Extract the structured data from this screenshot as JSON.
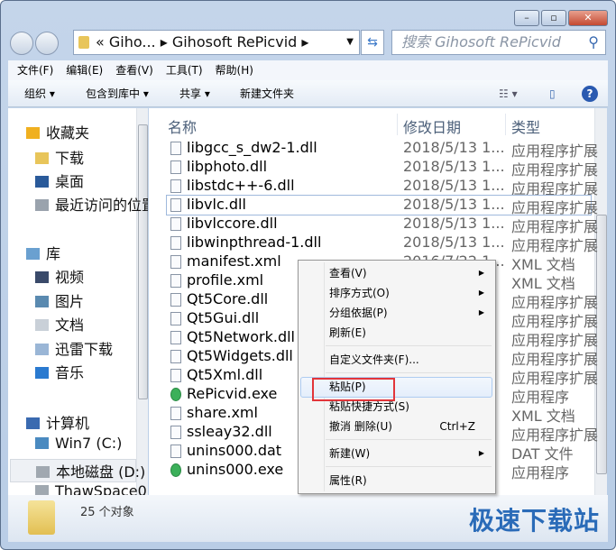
{
  "window": {
    "controls": [
      "minimize",
      "maximize",
      "close"
    ]
  },
  "address": {
    "path": "« Giho... ▸ Gihosoft RePicvid ▸",
    "search_placeholder": "搜索 Gihosoft RePicvid"
  },
  "menubar": [
    "文件(F)",
    "编辑(E)",
    "查看(V)",
    "工具(T)",
    "帮助(H)"
  ],
  "toolbar": {
    "organize": "组织 ▾",
    "include": "包含到库中 ▾",
    "share": "共享 ▾",
    "new_folder": "新建文件夹"
  },
  "nav": [
    {
      "label": "收藏夹",
      "icon": "star-icon",
      "color": "#f0b020",
      "indent": 0
    },
    {
      "label": "下载",
      "icon": "folder-icon",
      "color": "#e8c55a",
      "indent": 1
    },
    {
      "label": "桌面",
      "icon": "desktop-icon",
      "color": "#2a5a9a",
      "indent": 1
    },
    {
      "label": "最近访问的位置",
      "icon": "recent-icon",
      "color": "#9aa3ad",
      "indent": 1
    },
    {
      "label": "库",
      "icon": "library-icon",
      "color": "#6aa0d0",
      "indent": 0
    },
    {
      "label": "视频",
      "icon": "video-icon",
      "color": "#3a4a6a",
      "indent": 1
    },
    {
      "label": "图片",
      "icon": "picture-icon",
      "color": "#5a8ab0",
      "indent": 1
    },
    {
      "label": "文档",
      "icon": "document-icon",
      "color": "#c9d0d8",
      "indent": 1
    },
    {
      "label": "迅雷下载",
      "icon": "library-folder-icon",
      "color": "#9ab6d6",
      "indent": 1
    },
    {
      "label": "音乐",
      "icon": "music-icon",
      "color": "#2a7ad0",
      "indent": 1
    },
    {
      "label": "计算机",
      "icon": "computer-icon",
      "color": "#3a6ab0",
      "indent": 0
    },
    {
      "label": "Win7 (C:)",
      "icon": "system-drive-icon",
      "color": "#4a8ac0",
      "indent": 1
    },
    {
      "label": "本地磁盘 (D:)",
      "icon": "drive-icon",
      "color": "#a0a8b0",
      "indent": 1
    },
    {
      "label": "ThawSpace0",
      "icon": "drive-icon",
      "color": "#a0a8b0",
      "indent": 1
    }
  ],
  "columns": {
    "name": "名称",
    "date": "修改日期",
    "type": "类型"
  },
  "files": [
    {
      "name": "libgcc_s_dw2-1.dll",
      "date": "2018/5/13 1...",
      "type": "应用程序扩展",
      "kind": "dll"
    },
    {
      "name": "libphoto.dll",
      "date": "2018/5/13 1...",
      "type": "应用程序扩展",
      "kind": "dll"
    },
    {
      "name": "libstdc++-6.dll",
      "date": "2018/5/13 1...",
      "type": "应用程序扩展",
      "kind": "dll"
    },
    {
      "name": "libvlc.dll",
      "date": "2018/5/13 1...",
      "type": "应用程序扩展",
      "kind": "dll"
    },
    {
      "name": "libvlccore.dll",
      "date": "2018/5/13 1...",
      "type": "应用程序扩展",
      "kind": "dll"
    },
    {
      "name": "libwinpthread-1.dll",
      "date": "2018/5/13 1...",
      "type": "应用程序扩展",
      "kind": "dll"
    },
    {
      "name": "manifest.xml",
      "date": "2016/7/22 1...",
      "type": "XML 文档",
      "kind": "xml"
    },
    {
      "name": "profile.xml",
      "date": "",
      "type": "XML 文档",
      "kind": "xml"
    },
    {
      "name": "Qt5Core.dll",
      "date": "",
      "type": "应用程序扩展",
      "kind": "dll"
    },
    {
      "name": "Qt5Gui.dll",
      "date": "",
      "type": "应用程序扩展",
      "kind": "dll"
    },
    {
      "name": "Qt5Network.dll",
      "date": "",
      "type": "应用程序扩展",
      "kind": "dll"
    },
    {
      "name": "Qt5Widgets.dll",
      "date": "",
      "type": "应用程序扩展",
      "kind": "dll"
    },
    {
      "name": "Qt5Xml.dll",
      "date": "",
      "type": "应用程序扩展",
      "kind": "dll"
    },
    {
      "name": "RePicvid.exe",
      "date": "",
      "type": "应用程序",
      "kind": "exe"
    },
    {
      "name": "share.xml",
      "date": "",
      "type": "XML 文档",
      "kind": "xml"
    },
    {
      "name": "ssleay32.dll",
      "date": "",
      "type": "应用程序扩展",
      "kind": "dll"
    },
    {
      "name": "unins000.dat",
      "date": "",
      "type": "DAT 文件",
      "kind": "dat"
    },
    {
      "name": "unins000.exe",
      "date": "",
      "type": "应用程序",
      "kind": "exe"
    }
  ],
  "context_menu": [
    {
      "label": "查看(V)",
      "submenu": true
    },
    {
      "label": "排序方式(O)",
      "submenu": true
    },
    {
      "label": "分组依据(P)",
      "submenu": true
    },
    {
      "label": "刷新(E)"
    },
    {
      "sep": true
    },
    {
      "label": "自定义文件夹(F)..."
    },
    {
      "sep": true
    },
    {
      "label": "粘贴(P)",
      "highlighted": true
    },
    {
      "label": "粘贴快捷方式(S)"
    },
    {
      "label": "撤消 删除(U)",
      "shortcut": "Ctrl+Z"
    },
    {
      "sep": true
    },
    {
      "label": "新建(W)",
      "submenu": true
    },
    {
      "sep": true
    },
    {
      "label": "属性(R)"
    }
  ],
  "status": {
    "count": "25 个对象"
  },
  "watermark": "极速下载站"
}
